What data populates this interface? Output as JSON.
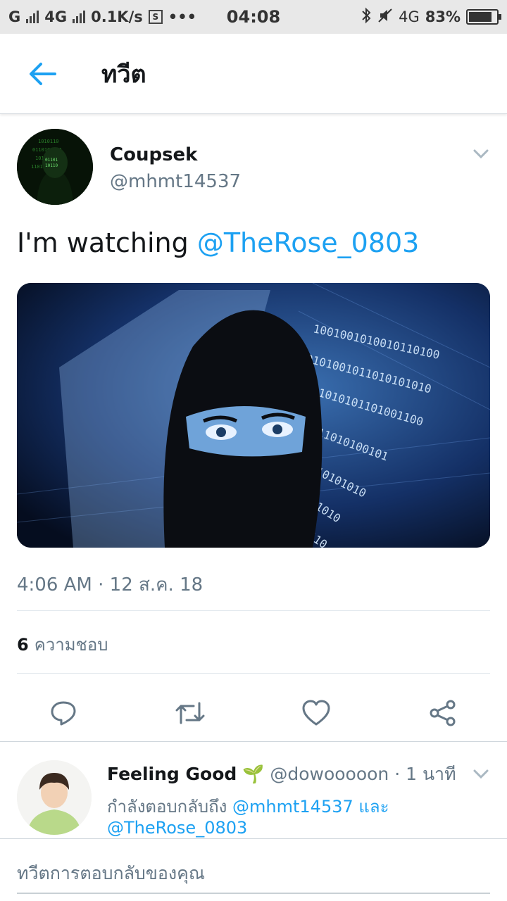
{
  "status_bar": {
    "carrier1": "G",
    "carrier2": "4G",
    "speed": "0.1K/s",
    "time": "04:08",
    "network": "4G",
    "battery": "83%",
    "battery_level": 0.83
  },
  "header": {
    "title": "ทวีต"
  },
  "tweet": {
    "author_name": "Coupsek",
    "author_handle": "@mhmt14537",
    "text": "I'm watching ",
    "mention": "@TheRose_0803",
    "timestamp": "4:06 AM · 12 ส.ค. 18",
    "like_count": "6",
    "like_label": "ความชอบ"
  },
  "reply": {
    "name": "Feeling Good",
    "emoji": "🌱",
    "handle_time": "@dowooooon · 1 นาที",
    "replying_to_prefix": "กำลังตอบกลับถึง ",
    "mention1": "@mhmt14537",
    "connector": " และ",
    "mention2": "@TheRose_0803"
  },
  "compose": {
    "placeholder": "ทวีตการตอบกลับของคุณ"
  },
  "colors": {
    "accent": "#1da1f2",
    "text": "#14171a",
    "secondary": "#657786",
    "divider": "#e1e8ed"
  },
  "icons": {
    "back": "arrow-left-icon",
    "caret": "chevron-down-icon",
    "reply": "comment-icon",
    "retweet": "retweet-icon",
    "like": "heart-icon",
    "share": "share-icon"
  }
}
